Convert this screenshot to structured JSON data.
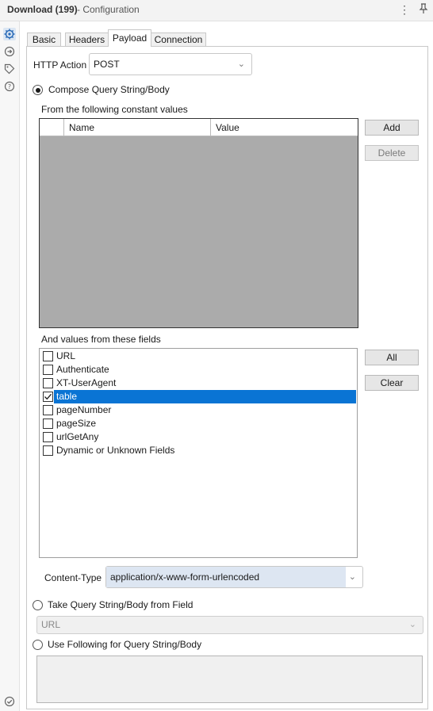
{
  "window": {
    "title_strong": "Download (199)",
    "title_rest": "- Configuration",
    "menu_icon": "kebab-menu-icon",
    "pin_icon": "pin-icon"
  },
  "rail": {
    "icons": [
      "gear-icon",
      "arrow-circle-icon",
      "tag-icon",
      "help-icon",
      "check-circle-icon"
    ]
  },
  "tabs": [
    {
      "label": "Basic",
      "active": false
    },
    {
      "label": "Headers",
      "active": false
    },
    {
      "label": "Payload",
      "active": true
    },
    {
      "label": "Connection",
      "active": false
    }
  ],
  "http_action": {
    "label": "HTTP Action",
    "value": "POST"
  },
  "compose": {
    "label": "Compose Query String/Body",
    "selected": true,
    "constants_label": "From the following constant values",
    "columns": [
      "Name",
      "Value"
    ],
    "add_label": "Add",
    "delete_label": "Delete"
  },
  "fields": {
    "label": "And values from these fields",
    "all_label": "All",
    "clear_label": "Clear",
    "items": [
      {
        "label": "URL",
        "checked": false,
        "selected": false
      },
      {
        "label": "Authenticate",
        "checked": false,
        "selected": false
      },
      {
        "label": "XT-UserAgent",
        "checked": false,
        "selected": false
      },
      {
        "label": "table",
        "checked": true,
        "selected": true
      },
      {
        "label": "pageNumber",
        "checked": false,
        "selected": false
      },
      {
        "label": "pageSize",
        "checked": false,
        "selected": false
      },
      {
        "label": "urlGetAny",
        "checked": false,
        "selected": false
      },
      {
        "label": "Dynamic or Unknown Fields",
        "checked": false,
        "selected": false
      }
    ]
  },
  "content_type": {
    "label": "Content-Type",
    "value": "application/x-www-form-urlencoded"
  },
  "take_from_field": {
    "label": "Take Query String/Body from Field",
    "selected": false,
    "field_value": "URL"
  },
  "use_following": {
    "label": "Use Following for Query String/Body",
    "selected": false,
    "value": ""
  }
}
